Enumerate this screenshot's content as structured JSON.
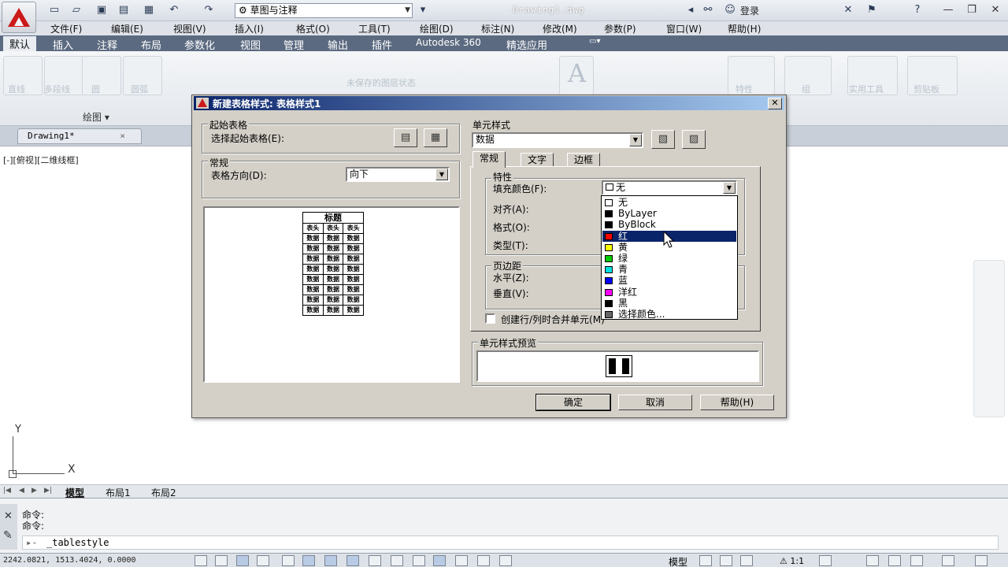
{
  "app": {
    "workspace": "草图与注释",
    "doc_title": "Drawing1.dwg",
    "login": "登录"
  },
  "menu": [
    "文件(F)",
    "编辑(E)",
    "视图(V)",
    "插入(I)",
    "格式(O)",
    "工具(T)",
    "绘图(D)",
    "标注(N)",
    "修改(M)",
    "参数(P)",
    "窗口(W)",
    "帮助(H)"
  ],
  "ribbon_tabs": [
    "默认",
    "插入",
    "注释",
    "布局",
    "参数化",
    "视图",
    "管理",
    "输出",
    "插件",
    "Autodesk 360",
    "精选应用"
  ],
  "ribbon": {
    "panel_draw": "绘图",
    "faded": [
      "直线",
      "多段线",
      "圆",
      "圆弧",
      "未保存的图层状态",
      "特性",
      "组",
      "实用工具",
      "剪贴板"
    ]
  },
  "drawing_tab": "Drawing1*",
  "viewport_label": "[-][俯视][二维线框]",
  "ucs": {
    "x": "X",
    "y": "Y"
  },
  "layout_tabs": [
    "模型",
    "布局1",
    "布局2"
  ],
  "command": {
    "history": [
      "命令:",
      "命令:"
    ],
    "input": "_tablestyle"
  },
  "status": {
    "coords": "2242.0821, 1513.4024, 0.0000",
    "model": "模型",
    "scale": "1:1"
  },
  "dialog": {
    "title": "新建表格样式: 表格样式1",
    "start_table_group": "起始表格",
    "select_start_table": "选择起始表格(E):",
    "general_group": "常规",
    "table_direction_label": "表格方向(D):",
    "table_direction_value": "向下",
    "cell_style_group": "单元样式",
    "cell_style_value": "数据",
    "tabs": [
      "常规",
      "文字",
      "边框"
    ],
    "properties_group": "特性",
    "fill_color_label": "填充颜色(F):",
    "fill_color_value": "无",
    "align_label": "对齐(A):",
    "format_label": "格式(O):",
    "type_label": "类型(T):",
    "margins_group": "页边距",
    "horizontal_label": "水平(Z):",
    "vertical_label": "垂直(V):",
    "merge_check_label": "创建行/列时合并单元(M)",
    "cell_preview_group": "单元样式预览",
    "ok": "确定",
    "cancel": "取消",
    "help": "帮助(H)",
    "preview_table": {
      "title": "标题",
      "header": [
        "表头",
        "表头",
        "表头"
      ],
      "data_cell": "数据",
      "rows": 8
    }
  },
  "color_options": [
    {
      "label": "无",
      "color": "#ffffff"
    },
    {
      "label": "ByLayer",
      "color": "#000000"
    },
    {
      "label": "ByBlock",
      "color": "#000000"
    },
    {
      "label": "红",
      "color": "#ff0000"
    },
    {
      "label": "黄",
      "color": "#ffff00"
    },
    {
      "label": "绿",
      "color": "#00cc00"
    },
    {
      "label": "青",
      "color": "#00e0e0"
    },
    {
      "label": "蓝",
      "color": "#0000ff"
    },
    {
      "label": "洋红",
      "color": "#ff00ff"
    },
    {
      "label": "黑",
      "color": "#000000"
    },
    {
      "label": "选择颜色...",
      "color": "#666666"
    }
  ],
  "selected_color_index": 3
}
